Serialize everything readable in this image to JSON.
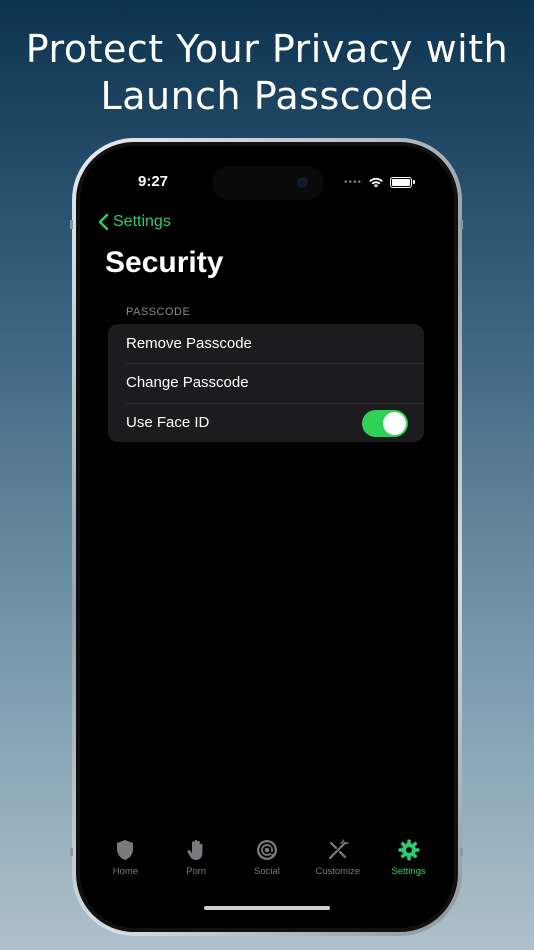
{
  "headline": {
    "line1": "Protect Your Privacy with",
    "line2": "Launch Passcode"
  },
  "status_bar": {
    "time": "9:27"
  },
  "nav": {
    "back_label": "Settings",
    "title": "Security"
  },
  "passcode_section": {
    "header": "PASSCODE",
    "rows": [
      {
        "label": "Remove Passcode"
      },
      {
        "label": "Change Passcode"
      },
      {
        "label": "Use Face ID",
        "toggle_on": true
      }
    ]
  },
  "tabbar": {
    "items": [
      {
        "label": "Home",
        "icon": "shield-icon",
        "active": false
      },
      {
        "label": "Porn",
        "icon": "hand-icon",
        "active": false
      },
      {
        "label": "Social",
        "icon": "at-icon",
        "active": false
      },
      {
        "label": "Customize",
        "icon": "wand-icon",
        "active": false
      },
      {
        "label": "Settings",
        "icon": "gear-icon",
        "active": true
      }
    ]
  },
  "colors": {
    "accent": "#2ecc71",
    "toggle_on": "#30d158"
  }
}
